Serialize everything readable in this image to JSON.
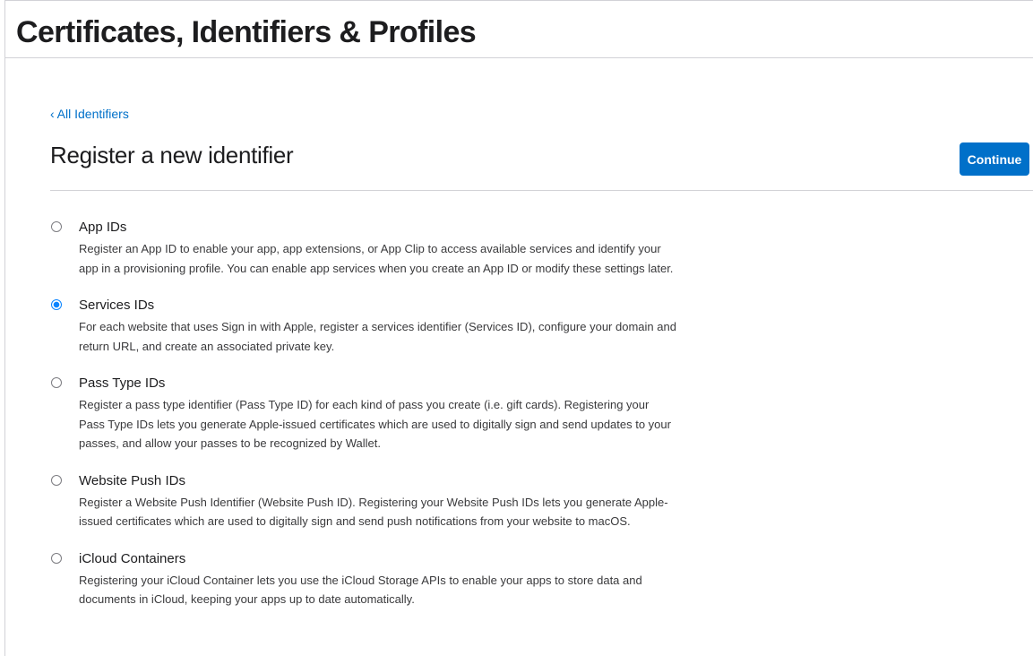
{
  "header": {
    "title": "Certificates, Identifiers & Profiles"
  },
  "nav": {
    "back_chevron": "‹",
    "back_label": "All Identifiers"
  },
  "main": {
    "title": "Register a new identifier",
    "continue_label": "Continue"
  },
  "options": [
    {
      "title": "App IDs",
      "selected": false,
      "description": "Register an App ID to enable your app, app extensions, or App Clip to access available services and identify your app in a provisioning profile. You can enable app services when you create an App ID or modify these settings later."
    },
    {
      "title": "Services IDs",
      "selected": true,
      "description": "For each website that uses Sign in with Apple, register a services identifier (Services ID), configure your domain and return URL, and create an associated private key."
    },
    {
      "title": "Pass Type IDs",
      "selected": false,
      "description": "Register a pass type identifier (Pass Type ID) for each kind of pass you create (i.e. gift cards). Registering your Pass Type IDs lets you generate Apple-issued certificates which are used to digitally sign and send updates to your passes, and allow your passes to be recognized by Wallet."
    },
    {
      "title": "Website Push IDs",
      "selected": false,
      "description": "Register a Website Push Identifier (Website Push ID). Registering your Website Push IDs lets you generate Apple-issued certificates which are used to digitally sign and send push notifications from your website to macOS."
    },
    {
      "title": "iCloud Containers",
      "selected": false,
      "description": "Registering your iCloud Container lets you use the iCloud Storage APIs to enable your apps to store data and documents in iCloud, keeping your apps up to date automatically."
    }
  ],
  "colors": {
    "accent": "#0070c9",
    "radio_selected": "#0a84ff",
    "divider": "#d2d2d7",
    "text": "#1d1d1f"
  }
}
